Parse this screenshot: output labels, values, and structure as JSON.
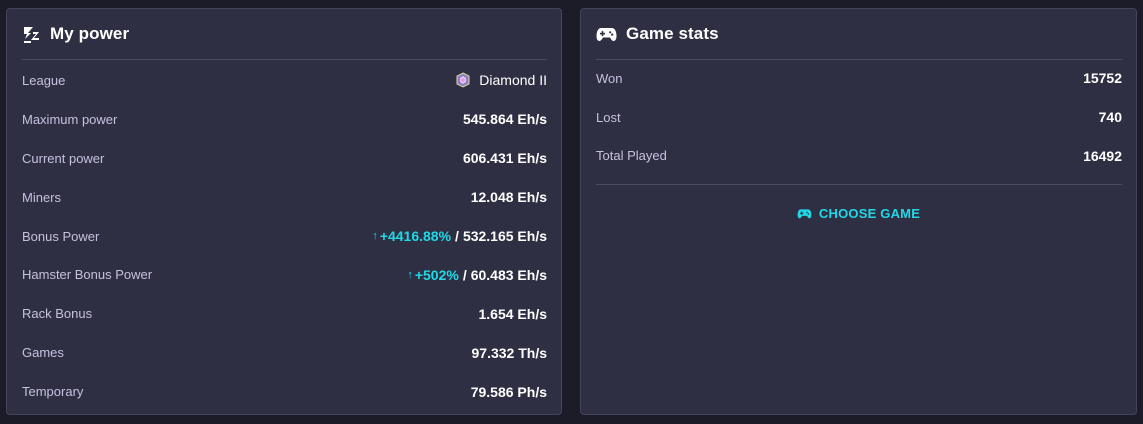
{
  "my_power": {
    "title": "My power",
    "rows": [
      {
        "label": "League",
        "value": "Diamond II"
      },
      {
        "label": "Maximum power",
        "value": "545.864 Eh/s"
      },
      {
        "label": "Current power",
        "value": "606.431 Eh/s"
      },
      {
        "label": "Miners",
        "value": "12.048 Eh/s"
      },
      {
        "label": "Bonus Power",
        "percent": "+4416.88%",
        "separator": "/",
        "value": "532.165 Eh/s"
      },
      {
        "label": "Hamster Bonus Power",
        "percent": "+502%",
        "separator": "/",
        "value": "60.483 Eh/s"
      },
      {
        "label": "Rack Bonus",
        "value": "1.654 Eh/s"
      },
      {
        "label": "Games",
        "value": "97.332 Th/s"
      },
      {
        "label": "Temporary",
        "value": "79.586 Ph/s"
      }
    ]
  },
  "game_stats": {
    "title": "Game stats",
    "rows": [
      {
        "label": "Won",
        "value": "15752"
      },
      {
        "label": "Lost",
        "value": "740"
      },
      {
        "label": "Total Played",
        "value": "16492"
      }
    ],
    "choose_game_label": "CHOOSE GAME"
  },
  "icons": {
    "power": "power-icon",
    "gamepad": "gamepad-icon",
    "league": "diamond-league-icon",
    "arrow_up": "arrow-up-icon"
  },
  "colors": {
    "background": "#1c1c28",
    "panel": "#2f2f44",
    "accent": "#21d9e6",
    "label": "#c6c1de",
    "value": "#ffffff"
  }
}
